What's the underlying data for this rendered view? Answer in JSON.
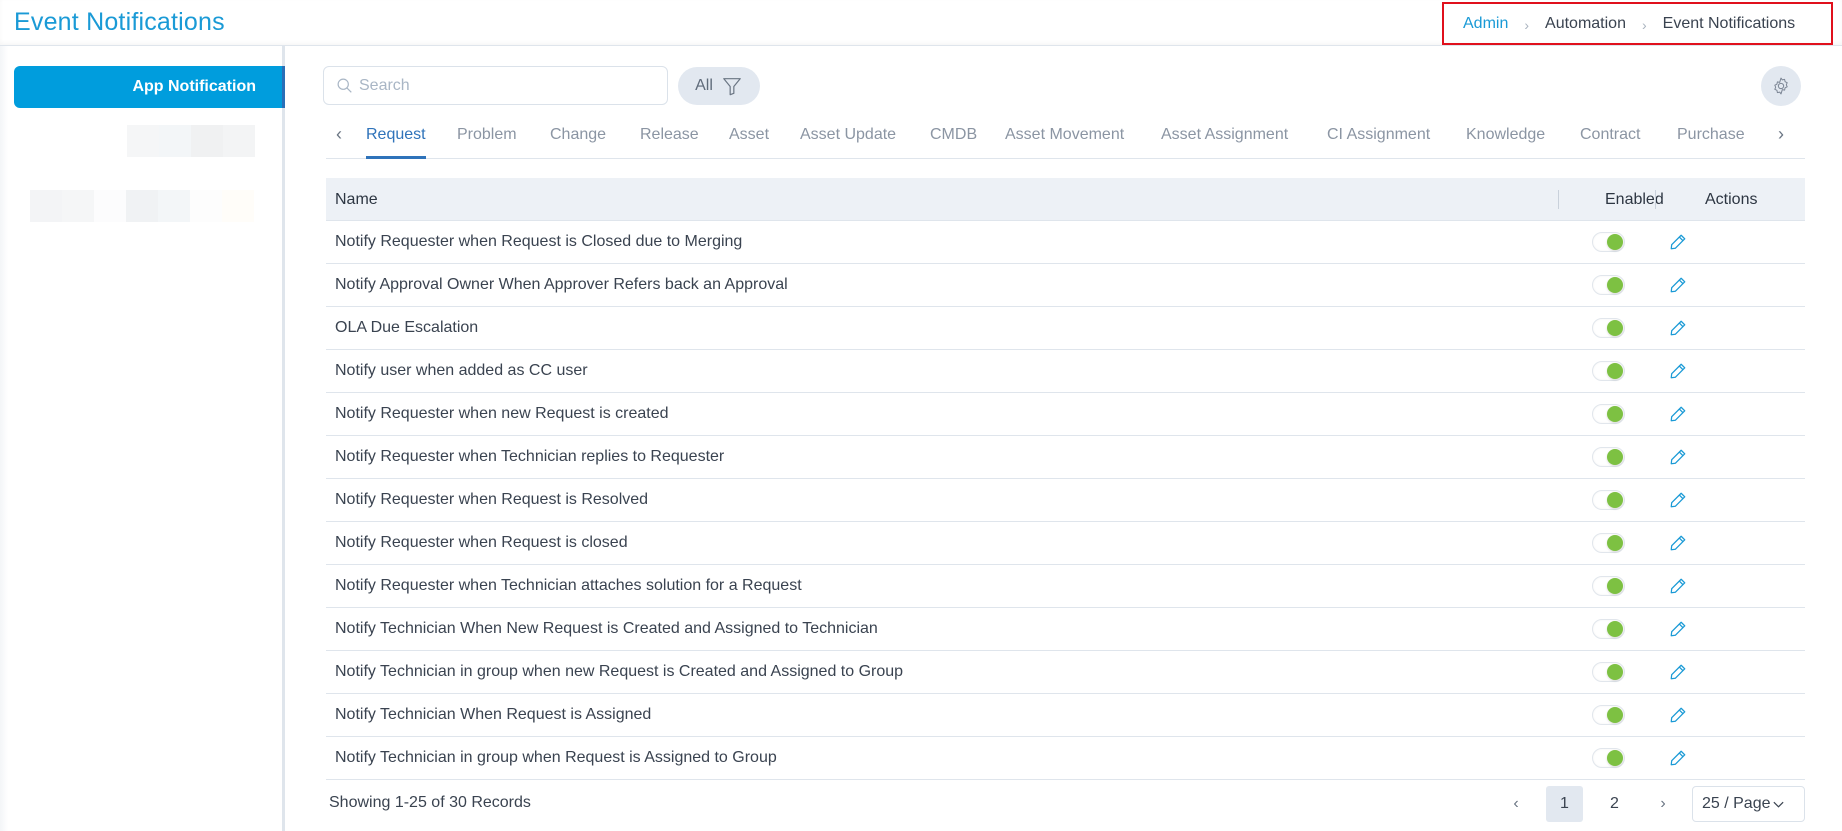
{
  "header": {
    "title": "Event Notifications",
    "breadcrumb": [
      {
        "label": "Admin",
        "link": true
      },
      {
        "label": "Automation",
        "link": false
      },
      {
        "label": "Event Notifications",
        "link": false
      }
    ],
    "breadcrumb_separator": "›"
  },
  "sidebar": {
    "active_item": "App Notification"
  },
  "toolbar": {
    "search_placeholder": "Search",
    "search_value": "",
    "filter_label": "All",
    "settings_icon": "gear-icon"
  },
  "tabs": {
    "prev_arrow": "‹",
    "next_arrow": "›",
    "items": [
      "Request",
      "Problem",
      "Change",
      "Release",
      "Asset",
      "Asset Update",
      "CMDB",
      "Asset Movement",
      "Asset Assignment",
      "CI Assignment",
      "Knowledge",
      "Contract",
      "Purchase"
    ],
    "active": "Request"
  },
  "table": {
    "columns": {
      "name": "Name",
      "enabled": "Enabled",
      "actions": "Actions"
    },
    "rows": [
      {
        "name": "Notify Requester when Request is Closed due to Merging",
        "enabled": true
      },
      {
        "name": "Notify Approval Owner When Approver Refers back an Approval",
        "enabled": true
      },
      {
        "name": "OLA Due Escalation",
        "enabled": true
      },
      {
        "name": "Notify user when added as CC user",
        "enabled": true
      },
      {
        "name": "Notify Requester when new Request is created",
        "enabled": true
      },
      {
        "name": "Notify Requester when Technician replies to Requester",
        "enabled": true
      },
      {
        "name": "Notify Requester when Request is Resolved",
        "enabled": true
      },
      {
        "name": "Notify Requester when Request is closed",
        "enabled": true
      },
      {
        "name": "Notify Requester when Technician attaches solution for a Request",
        "enabled": true
      },
      {
        "name": "Notify Technician When New Request is Created and Assigned to Technician",
        "enabled": true
      },
      {
        "name": "Notify Technician in group when new Request is Created and Assigned to Group",
        "enabled": true
      },
      {
        "name": "Notify Technician When Request is Assigned",
        "enabled": true
      },
      {
        "name": "Notify Technician in group when Request is Assigned to Group",
        "enabled": true
      }
    ]
  },
  "footer": {
    "records_text": "Showing 1-25 of 30 Records",
    "prev": "‹",
    "next": "›",
    "pages": [
      "1",
      "2"
    ],
    "current_page": "1",
    "page_size": "25 / Page"
  },
  "colors": {
    "brand": "#009ddd",
    "active_tab": "#2f73ba",
    "toggle_on": "#7dc142",
    "breadcrumb_highlight": "#e0101c"
  }
}
